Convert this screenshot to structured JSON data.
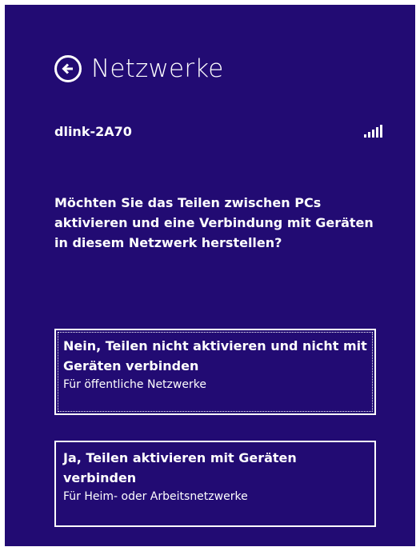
{
  "header": {
    "back_icon": "back-arrow-circle-icon",
    "title": "Netzwerke"
  },
  "network": {
    "name": "dlink-2A70",
    "signal_icon": "wifi-signal-icon",
    "signal_bars": 5
  },
  "prompt": {
    "question": "Möchten Sie das Teilen zwischen PCs aktivieren und eine Verbindung mit Geräten in diesem Netzwerk herstellen?"
  },
  "options": [
    {
      "title": "Nein, Teilen nicht aktivieren und nicht mit Geräten verbinden",
      "subtitle": "Für öffentliche Netzwerke"
    },
    {
      "title": "Ja, Teilen aktivieren mit Geräten verbinden",
      "subtitle": "Für Heim- oder Arbeitsnetzwerke"
    }
  ],
  "colors": {
    "background": "#220b73",
    "foreground": "#ffffff"
  }
}
